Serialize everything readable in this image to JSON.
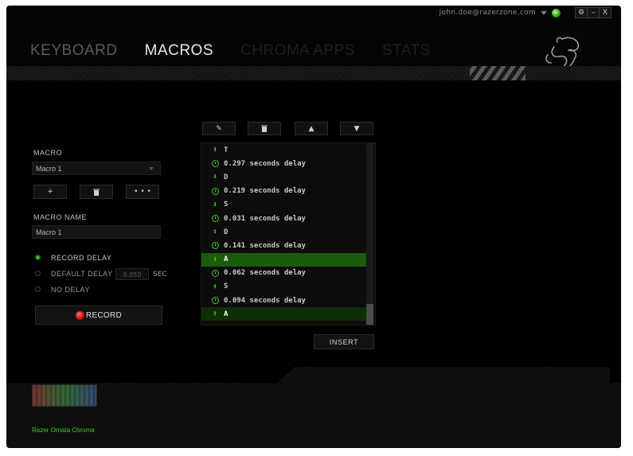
{
  "header": {
    "user_email": "john.doe@razerzone.com",
    "window_buttons": [
      "⚙",
      "–",
      "X"
    ]
  },
  "nav": {
    "tabs": [
      {
        "label": "KEYBOARD",
        "state": "inactive"
      },
      {
        "label": "MACROS",
        "state": "active"
      },
      {
        "label": "CHROMA APPS",
        "state": "disabled"
      },
      {
        "label": "STATS",
        "state": "disabled"
      }
    ]
  },
  "macro": {
    "section_label": "MACRO",
    "selected": "Macro 1",
    "buttons": {
      "add": "+",
      "delete": "🗑",
      "more": "• • •"
    },
    "name_label": "MACRO NAME",
    "name_value": "Macro 1"
  },
  "delay_options": {
    "record_delay": "RECORD DELAY",
    "default_delay": "DEFAULT DELAY",
    "default_delay_value": "0.050",
    "sec_label": "SEC",
    "no_delay": "NO DELAY",
    "selected": "record_delay"
  },
  "record_button": {
    "label": "RECORD"
  },
  "editor": {
    "toolbar": {
      "edit": "✎",
      "delete": "🗑",
      "up": "▲",
      "down": "▼"
    },
    "events": [
      {
        "type": "up",
        "text": "T"
      },
      {
        "type": "delay",
        "text": "0.297 seconds delay"
      },
      {
        "type": "down",
        "text": "D"
      },
      {
        "type": "delay",
        "text": "0.219 seconds delay"
      },
      {
        "type": "down",
        "text": "S"
      },
      {
        "type": "delay",
        "text": "0.031 seconds delay"
      },
      {
        "type": "up",
        "text": "D"
      },
      {
        "type": "delay",
        "text": "0.141 seconds delay"
      },
      {
        "type": "down",
        "text": "A",
        "highlight": "selected"
      },
      {
        "type": "delay",
        "text": "0.062 seconds delay"
      },
      {
        "type": "up",
        "text": "S"
      },
      {
        "type": "delay",
        "text": "0.094 seconds delay"
      },
      {
        "type": "up",
        "text": "A",
        "highlight": "hover"
      }
    ],
    "insert_label": "INSERT"
  },
  "footer": {
    "device_name": "Razer Ornata Chroma"
  },
  "colors": {
    "accent": "#44d21b",
    "selected_row": "#1c5a0c",
    "record": "#d10a0a"
  }
}
